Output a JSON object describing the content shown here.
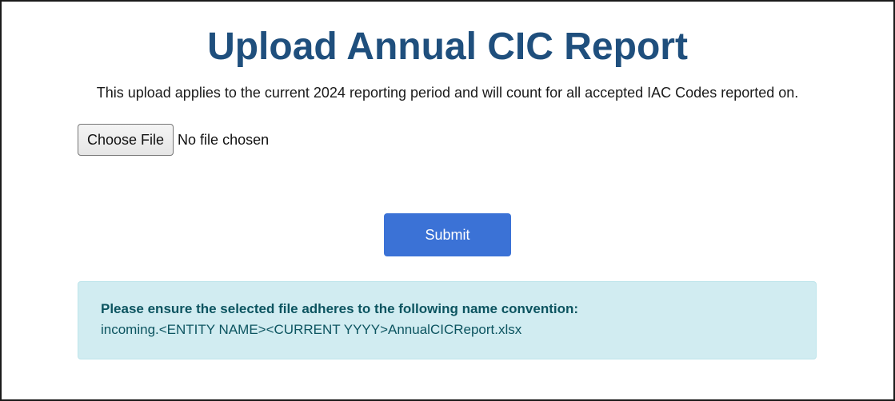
{
  "page": {
    "title": "Upload Annual CIC Report",
    "description": "This upload applies to the current 2024 reporting period and will count for all accepted IAC Codes reported on."
  },
  "file_input": {
    "button_label": "Choose File",
    "status": "No file chosen"
  },
  "submit": {
    "label": "Submit"
  },
  "notice": {
    "heading": "Please ensure the selected file adheres to the following name convention:",
    "body": "incoming.<ENTITY NAME><CURRENT YYYY>AnnualCICReport.xlsx"
  },
  "colors": {
    "title": "#1f4f7d",
    "submit_background": "#3b72d6",
    "notice_background": "#d1ecf1",
    "notice_text": "#0c5460"
  }
}
